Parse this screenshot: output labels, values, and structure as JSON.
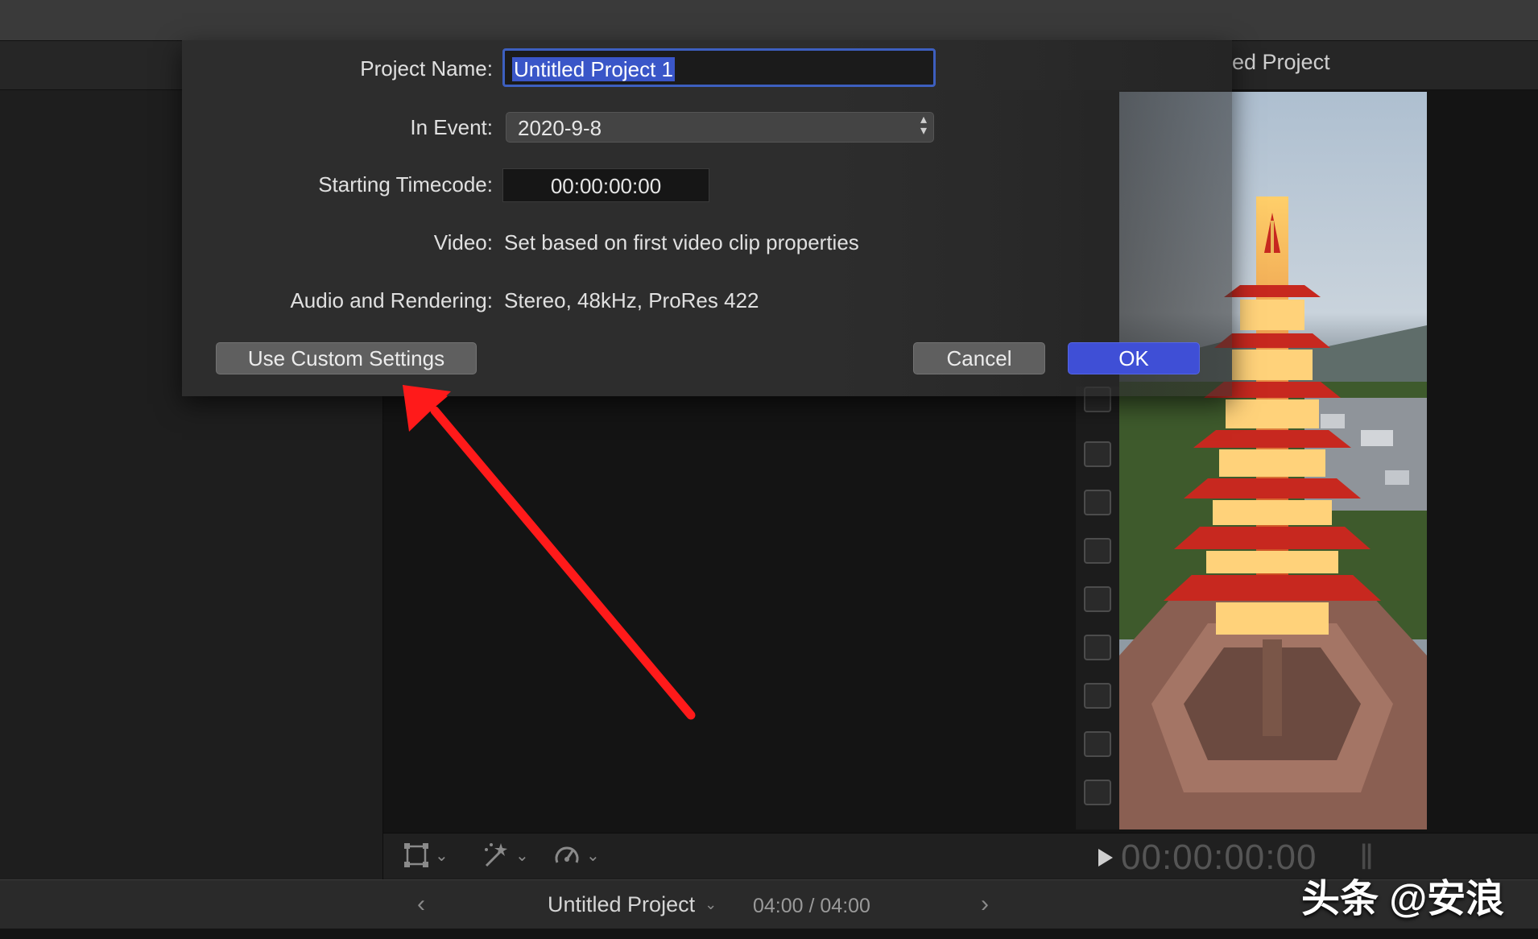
{
  "dialog": {
    "project_name_label": "Project Name:",
    "project_name_value": "Untitled Project 1",
    "event_label": "In Event:",
    "event_value": "2020-9-8",
    "timecode_label": "Starting Timecode:",
    "timecode_value": "00:00:00:00",
    "video_label": "Video:",
    "video_value": "Set based on first video clip properties",
    "audio_label": "Audio and Rendering:",
    "audio_value": "Stereo, 48kHz, ProRes 422",
    "custom_settings_label": "Use Custom Settings",
    "cancel_label": "Cancel",
    "ok_label": "OK"
  },
  "viewer": {
    "title_partial": "ed Project",
    "timecode": "00:00:00:00"
  },
  "timeline_bar": {
    "project_name": "Untitled Project",
    "duration": "04:00 / 04:00"
  },
  "watermark": "头条 @安浪",
  "icons": {
    "transform": "transform-icon",
    "enhance": "magic-wand-icon",
    "retime": "speedometer-icon",
    "play": "play-icon",
    "prev": "chevron-left-icon",
    "next": "chevron-right-icon"
  },
  "colors": {
    "ok_button": "#3f4fd6",
    "selection": "#3a56c8",
    "annotation_arrow": "#ff1a1a"
  }
}
